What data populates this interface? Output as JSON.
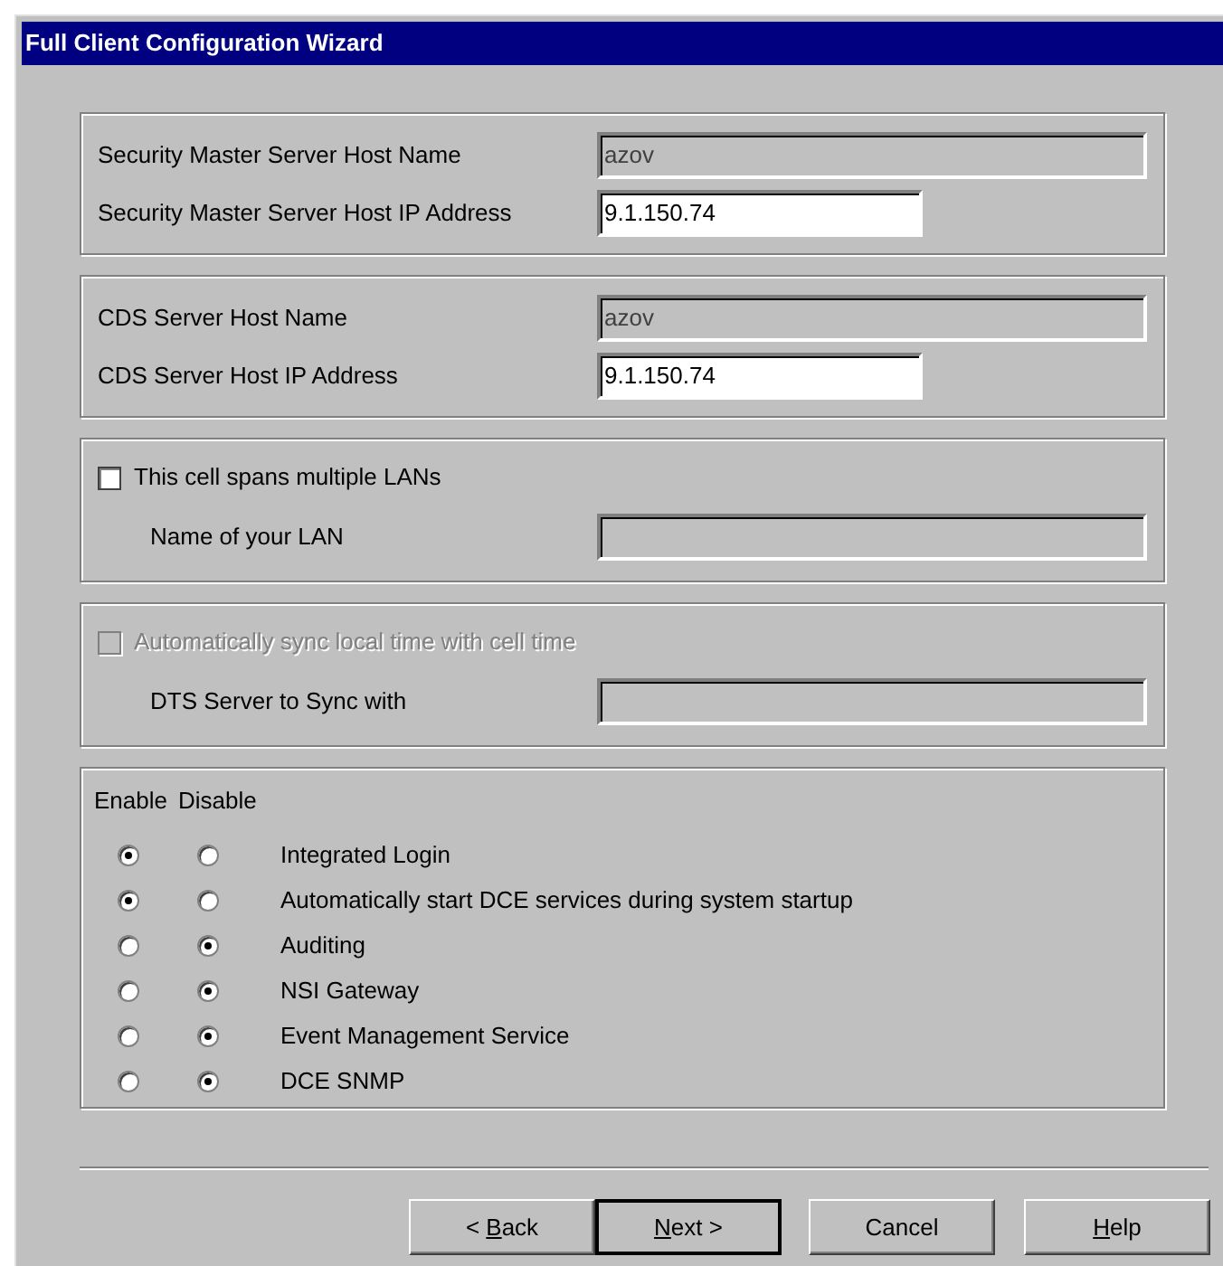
{
  "window": {
    "title": "Full Client Configuration Wizard"
  },
  "groups": [
    {
      "kind": "fields",
      "fields": [
        {
          "label": "Security Master Server Host Name",
          "value": "azov",
          "disabled": true
        },
        {
          "label": "Security Master Server Host IP Address",
          "value": "9.1.150.74",
          "disabled": false
        }
      ]
    },
    {
      "kind": "fields",
      "fields": [
        {
          "label": "CDS Server Host Name",
          "value": "azov",
          "disabled": true
        },
        {
          "label": "CDS Server Host IP Address",
          "value": "9.1.150.74",
          "disabled": false
        }
      ]
    },
    {
      "kind": "checkbox",
      "checkbox": {
        "label": "This cell spans multiple LANs",
        "checked": false,
        "disabled": false
      },
      "field": {
        "label": "Name of your LAN",
        "disabled": true
      }
    },
    {
      "kind": "checkbox",
      "checkbox": {
        "label": "Automatically sync local time with cell time",
        "checked": false,
        "disabled": true
      },
      "field": {
        "label": "DTS Server to Sync with",
        "disabled": true
      }
    }
  ],
  "services": {
    "headers": [
      "Enable",
      "Disable"
    ],
    "rows": [
      {
        "label": "Integrated Login",
        "options": [
          {
            "selected": true
          },
          {
            "selected": false
          }
        ]
      },
      {
        "label": "Automatically start DCE services during system startup",
        "options": [
          {
            "selected": true
          },
          {
            "selected": false
          }
        ]
      },
      {
        "label": "Auditing",
        "options": [
          {
            "selected": false
          },
          {
            "selected": true
          }
        ]
      },
      {
        "label": "NSI Gateway",
        "options": [
          {
            "selected": false
          },
          {
            "selected": true
          }
        ]
      },
      {
        "label": "Event Management Service",
        "options": [
          {
            "selected": false
          },
          {
            "selected": true
          }
        ]
      },
      {
        "label": "DCE SNMP",
        "options": [
          {
            "selected": false
          },
          {
            "selected": true
          }
        ]
      }
    ]
  },
  "buttons": [
    {
      "before": "< ",
      "accel": "B",
      "after": "ack",
      "default": false
    },
    {
      "accel": "N",
      "after": "ext >",
      "default": true
    },
    {
      "before": "Cancel",
      "default": false
    },
    {
      "accel": "H",
      "after": "elp",
      "default": false
    }
  ]
}
